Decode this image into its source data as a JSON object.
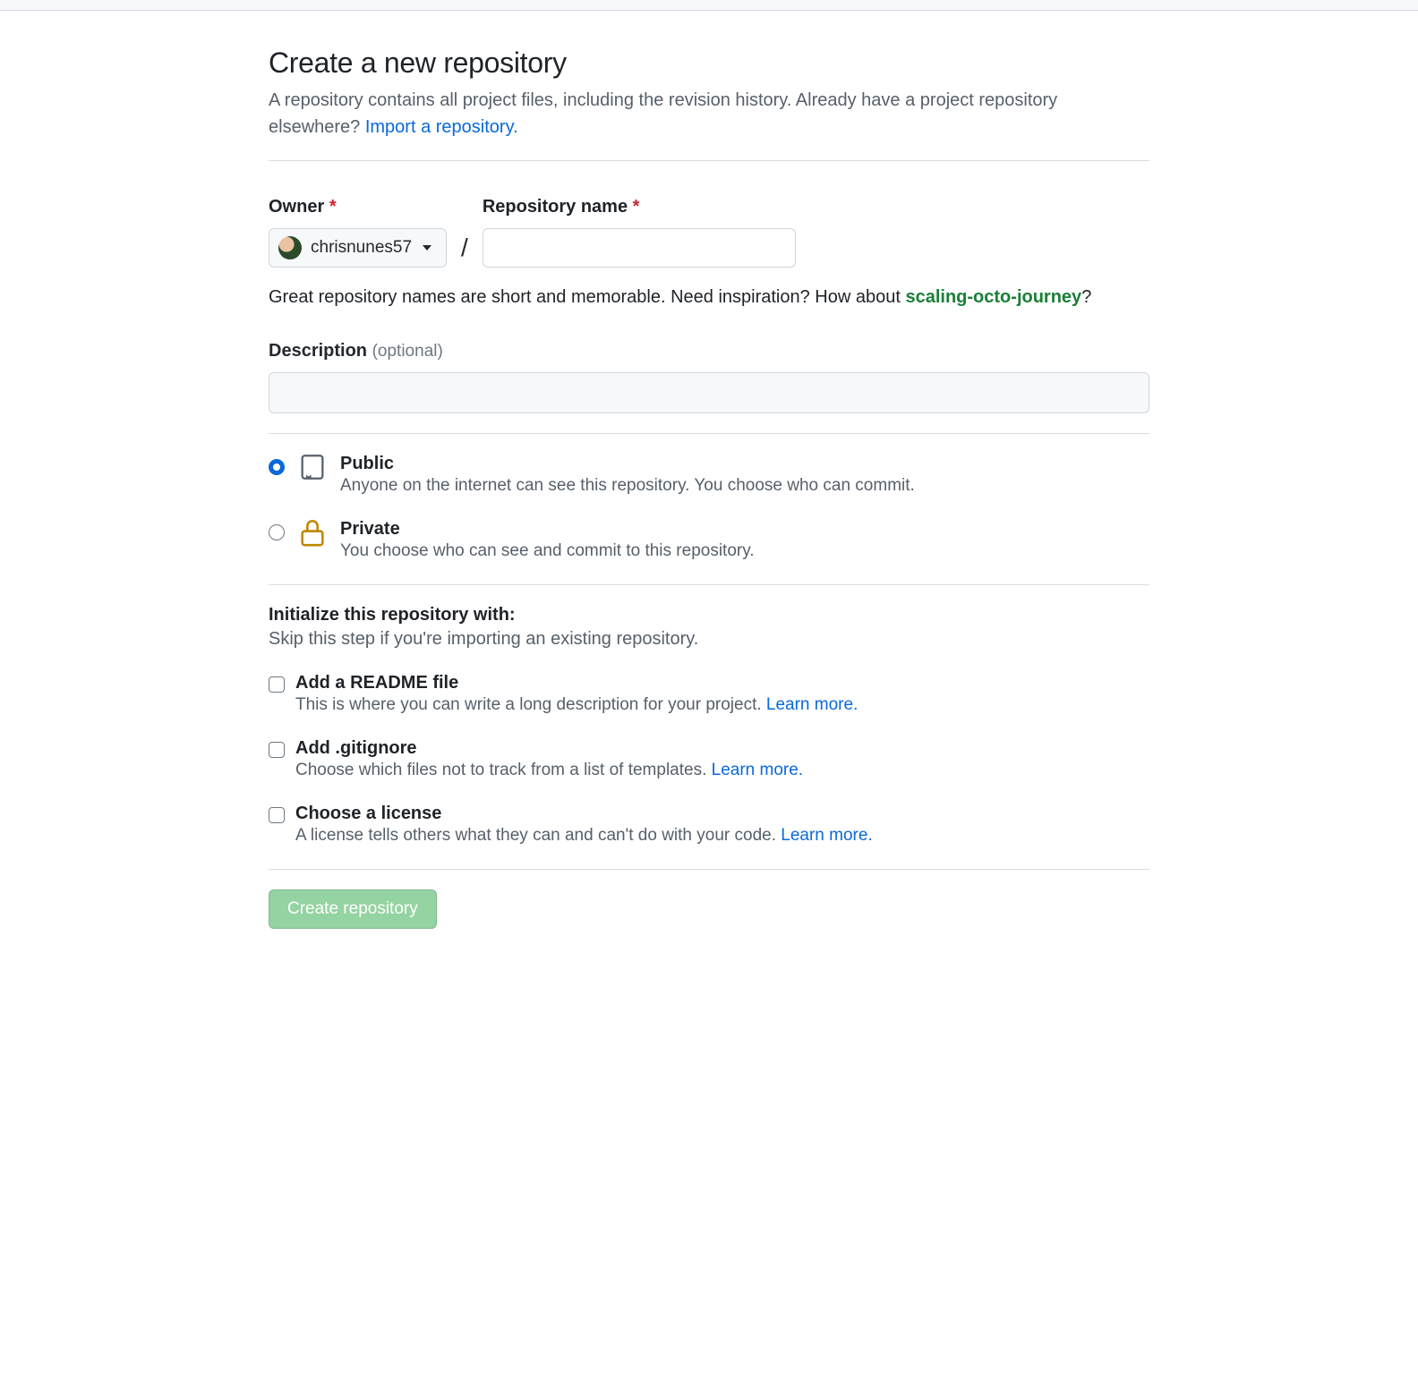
{
  "heading": "Create a new repository",
  "subhead_text": "A repository contains all project files, including the revision history. Already have a project repository elsewhere? ",
  "subhead_link": "Import a repository.",
  "owner": {
    "label": "Owner",
    "selected": "chrisnunes57"
  },
  "repo_name": {
    "label": "Repository name"
  },
  "hint_pre": "Great repository names are short and memorable. Need inspiration? How about ",
  "hint_suggestion": "scaling-octo-journey",
  "hint_post": "?",
  "description": {
    "label": "Description",
    "optional": "(optional)"
  },
  "visibility": {
    "public": {
      "title": "Public",
      "desc": "Anyone on the internet can see this repository. You choose who can commit."
    },
    "private": {
      "title": "Private",
      "desc": "You choose who can see and commit to this repository."
    }
  },
  "initialize": {
    "heading": "Initialize this repository with:",
    "sub": "Skip this step if you're importing an existing repository.",
    "readme": {
      "title": "Add a README file",
      "desc": "This is where you can write a long description for your project. ",
      "link": "Learn more."
    },
    "gitignore": {
      "title": "Add .gitignore",
      "desc": "Choose which files not to track from a list of templates. ",
      "link": "Learn more."
    },
    "license": {
      "title": "Choose a license",
      "desc": "A license tells others what they can and can't do with your code. ",
      "link": "Learn more."
    }
  },
  "submit_label": "Create repository"
}
